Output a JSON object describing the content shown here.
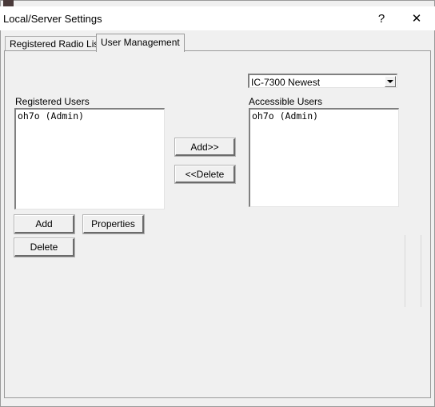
{
  "window": {
    "title": "Local/Server Settings",
    "help_label": "?",
    "close_label": "✕"
  },
  "tabs": [
    {
      "label": "Registered Radio List",
      "active": false
    },
    {
      "label": "User Management",
      "active": true
    }
  ],
  "radio_select": {
    "value": "IC-7300 Newest"
  },
  "registered_users": {
    "label": "Registered Users",
    "items": [
      "oh7o (Admin)"
    ]
  },
  "accessible_users": {
    "label": "Accessible Users",
    "items": [
      "oh7o (Admin)"
    ]
  },
  "buttons": {
    "add_to": "Add>>",
    "remove_from": "<<Delete",
    "add": "Add",
    "properties": "Properties",
    "delete": "Delete"
  }
}
